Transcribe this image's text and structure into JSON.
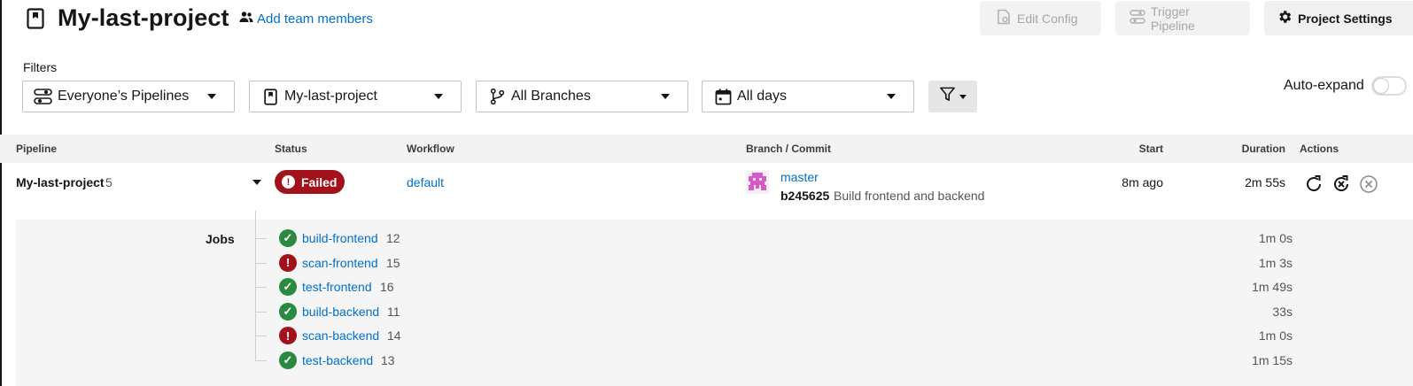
{
  "header": {
    "project_title": "My-last-project",
    "add_team_label": "Add team members",
    "edit_config_label": "Edit Config",
    "trigger_pipeline_label": "Trigger Pipeline",
    "project_settings_label": "Project Settings"
  },
  "filters": {
    "label": "Filters",
    "pipelines": "Everyone’s Pipelines",
    "project": "My-last-project",
    "branches": "All Branches",
    "days": "All days",
    "auto_expand_label": "Auto-expand",
    "auto_expand_on": false
  },
  "table": {
    "columns": {
      "pipeline": "Pipeline",
      "status": "Status",
      "workflow": "Workflow",
      "branch_commit": "Branch / Commit",
      "start": "Start",
      "duration": "Duration",
      "actions": "Actions"
    },
    "pipeline": {
      "name": "My-last-project",
      "number": "5",
      "status": "Failed",
      "workflow": "default",
      "branch": "master",
      "commit_hash": "b245625",
      "commit_message": "Build frontend and backend",
      "start": "8m ago",
      "duration": "2m 55s"
    },
    "jobs_label": "Jobs",
    "jobs": [
      {
        "name": "build-frontend",
        "number": "12",
        "status": "success",
        "duration": "1m 0s"
      },
      {
        "name": "scan-frontend",
        "number": "15",
        "status": "failed",
        "duration": "1m 3s"
      },
      {
        "name": "test-frontend",
        "number": "16",
        "status": "success",
        "duration": "1m 49s"
      },
      {
        "name": "build-backend",
        "number": "11",
        "status": "success",
        "duration": "33s"
      },
      {
        "name": "scan-backend",
        "number": "14",
        "status": "failed",
        "duration": "1m 0s"
      },
      {
        "name": "test-backend",
        "number": "13",
        "status": "success",
        "duration": "1m 15s"
      }
    ]
  },
  "colors": {
    "link": "#0070c9",
    "failed": "#a2121b",
    "success": "#2a8a3f",
    "avatar": "#d957c8"
  }
}
